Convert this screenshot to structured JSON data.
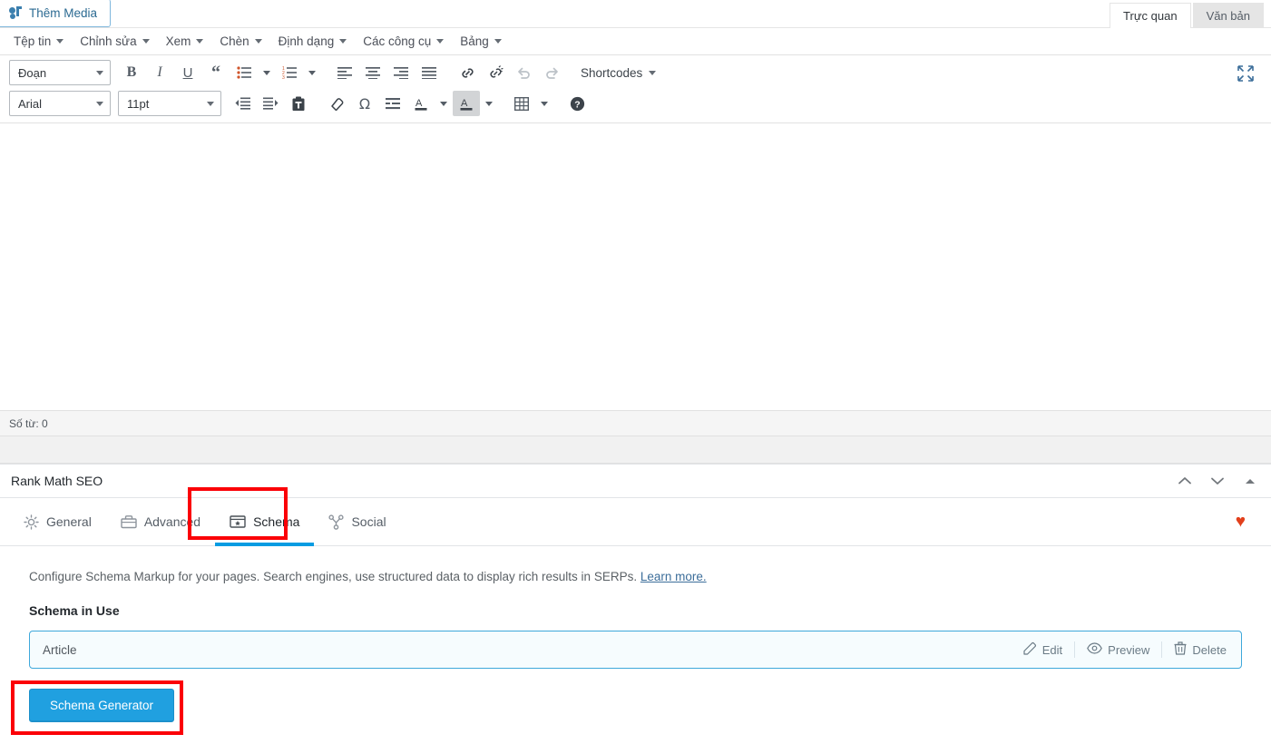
{
  "media": {
    "add_media_label": "Thêm Media",
    "icon": "media-icon"
  },
  "editor_view_tabs": [
    {
      "label": "Trực quan",
      "active": true
    },
    {
      "label": "Văn bản",
      "active": false
    }
  ],
  "menubar": [
    {
      "label": "Tệp tin"
    },
    {
      "label": "Chỉnh sửa"
    },
    {
      "label": "Xem"
    },
    {
      "label": "Chèn"
    },
    {
      "label": "Định dạng"
    },
    {
      "label": "Các công cụ"
    },
    {
      "label": "Bảng"
    }
  ],
  "toolbar": {
    "row1": {
      "paragraph_select": "Đoạn",
      "bold": "B",
      "italic": "I",
      "underline": "U",
      "blockquote": "“",
      "shortcodes_label": "Shortcodes"
    },
    "row2": {
      "font_select": "Arial",
      "size_select": "11pt"
    }
  },
  "status": {
    "word_count": "Số từ: 0"
  },
  "rank_math": {
    "title": "Rank Math SEO",
    "tabs": [
      {
        "label": "General",
        "icon": "gear-icon",
        "active": false
      },
      {
        "label": "Advanced",
        "icon": "toolbox-icon",
        "active": false
      },
      {
        "label": "Schema",
        "icon": "schema-icon",
        "active": true
      },
      {
        "label": "Social",
        "icon": "share-icon",
        "active": false
      }
    ],
    "heart_icon": "♥",
    "description": "Configure Schema Markup for your pages. Search engines, use structured data to display rich results in SERPs.",
    "learn_more": "Learn more.",
    "subtitle": "Schema in Use",
    "schema_row": {
      "name": "Article",
      "actions": [
        {
          "label": "Edit",
          "icon": "edit-icon"
        },
        {
          "label": "Preview",
          "icon": "eye-icon"
        },
        {
          "label": "Delete",
          "icon": "trash-icon"
        }
      ]
    },
    "generator_button": "Schema Generator"
  },
  "colors": {
    "accent_blue": "#059ce2",
    "button_blue": "#20a0e0",
    "highlight_red": "#fb0007",
    "heart_red": "#e2401c",
    "schema_row_border": "#3ea8db"
  }
}
